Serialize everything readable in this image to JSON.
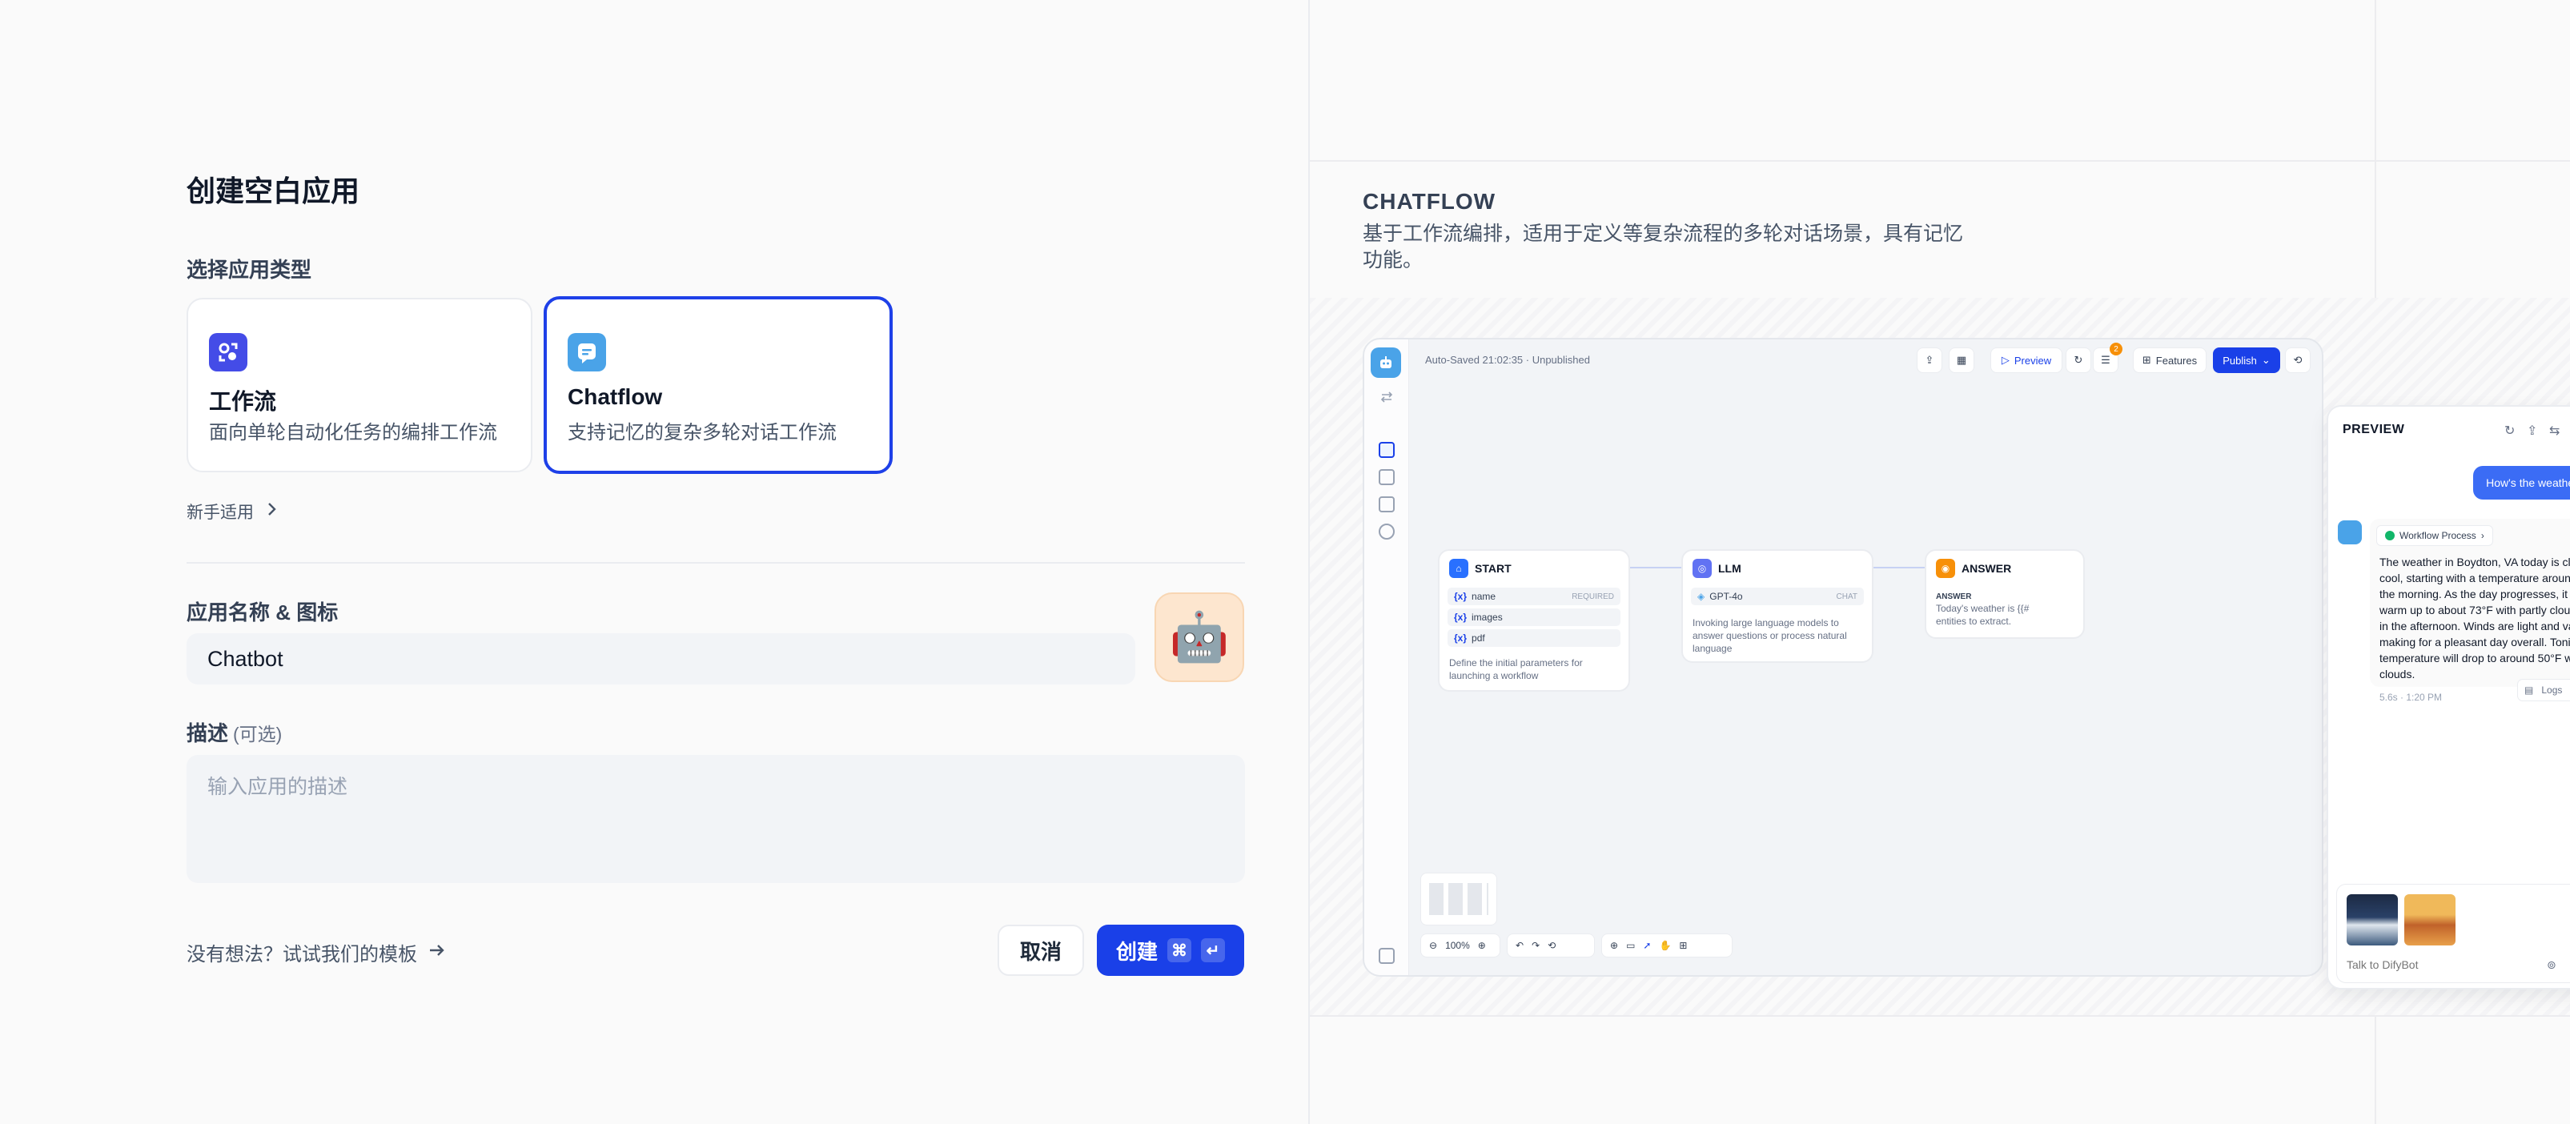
{
  "left": {
    "title": "创建空白应用",
    "type_section_label": "选择应用类型",
    "cards": [
      {
        "title": "工作流",
        "desc": "面向单轮自动化任务的编排工作流",
        "selected": false,
        "icon": "workflow-icon",
        "color": "#444ce7"
      },
      {
        "title": "Chatflow",
        "desc": "支持记忆的复杂多轮对话工作流",
        "selected": true,
        "icon": "chatflow-icon",
        "color": "#4aa3e8"
      }
    ],
    "newbie_link": "新手适用",
    "name_label": "应用名称 & 图标",
    "name_value": "Chatbot",
    "avatar_emoji": "🤖",
    "desc_label": "描述",
    "desc_optional": "(可选)",
    "desc_placeholder": "输入应用的描述",
    "template_link": "没有想法？试试我们的模板",
    "cancel_label": "取消",
    "create_label": "创建",
    "create_shortcut_1": "⌘",
    "create_shortcut_2": "↵"
  },
  "right": {
    "title": "CHATFLOW",
    "desc": "基于工作流编排，适用于定义等复杂流程的多轮对话场景，具有记忆功能。",
    "mock": {
      "autosave": "Auto-Saved 21:02:35 · Unpublished",
      "toolbar": {
        "preview": "Preview",
        "features": "Features",
        "publish": "Publish",
        "badge": "2"
      },
      "start_node": {
        "title": "START",
        "vars": [
          {
            "name": "name",
            "tag": "REQUIRED"
          },
          {
            "name": "images",
            "tag": ""
          },
          {
            "name": "pdf",
            "tag": ""
          }
        ],
        "desc_1": "Define the initial parameters for",
        "desc_2": "launching a workflow"
      },
      "llm_node": {
        "title": "LLM",
        "model": "GPT-4o",
        "mode": "CHAT",
        "desc_1": "Invoking large language models to",
        "desc_2": "answer questions or process natural",
        "desc_3": "language"
      },
      "answer_node": {
        "title": "ANSWER",
        "label": "ANSWER",
        "text_1": "Today's weather is {{#",
        "text_2": "entities to extract."
      },
      "zoom": "100%",
      "preview_panel": {
        "title": "PREVIEW",
        "user_msg": "How's the weather today",
        "workflow_chip": "Workflow Process",
        "bot_msg": "The weather in Boydton, VA today is clear and cool, starting with a temperature around 44°F in the morning. As the day progresses, it will warm up to about 73°F with partly cloudy skies in the afternoon. Winds are light and variable, making for a pleasant day overall. Tonight, the temperature will drop to around 50°F with a few clouds.",
        "meta": "5.6s · 1:20 PM",
        "logs": "Logs",
        "input_placeholder": "Talk to DifyBot"
      }
    }
  },
  "colors": {
    "accent": "#1a40e8",
    "workflow": "#444ce7",
    "chatflow": "#4aa3e8",
    "answer": "#f79009"
  }
}
